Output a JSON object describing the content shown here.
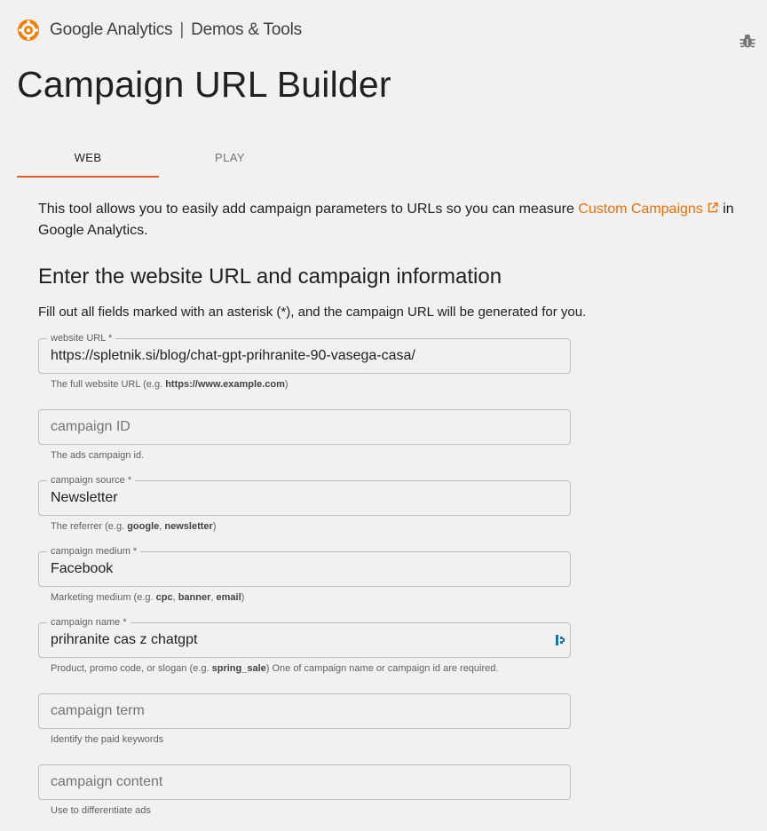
{
  "brand": {
    "name": "Google Analytics",
    "separator": "|",
    "section": "Demos & Tools"
  },
  "page_title": "Campaign URL Builder",
  "tabs": [
    {
      "label": "WEB",
      "active": true
    },
    {
      "label": "PLAY",
      "active": false
    }
  ],
  "intro": {
    "text_before": "This tool allows you to easily add campaign parameters to URLs so you can measure ",
    "link": "Custom Campaigns",
    "text_after": " in Google Analytics."
  },
  "section_title": "Enter the website URL and campaign information",
  "instructions": "Fill out all fields marked with an asterisk (*), and the campaign URL will be generated for you.",
  "fields": [
    {
      "label": "website URL *",
      "value": "https://spletnik.si/blog/chat-gpt-prihranite-90-vasega-casa/",
      "placeholder": "",
      "helper_pre": "The full website URL (e.g. ",
      "helper_b1": "https://www.example.com",
      "helper_mid": "",
      "helper_b2": "",
      "helper_mid2": "",
      "helper_b3": "",
      "helper_post": ")"
    },
    {
      "label": "",
      "value": "",
      "placeholder": "campaign ID",
      "helper_pre": "The ads campaign id.",
      "helper_b1": "",
      "helper_mid": "",
      "helper_b2": "",
      "helper_mid2": "",
      "helper_b3": "",
      "helper_post": ""
    },
    {
      "label": "campaign source *",
      "value": "Newsletter",
      "placeholder": "",
      "helper_pre": "The referrer (e.g. ",
      "helper_b1": "google",
      "helper_mid": ", ",
      "helper_b2": "newsletter",
      "helper_mid2": "",
      "helper_b3": "",
      "helper_post": ")"
    },
    {
      "label": "campaign medium *",
      "value": "Facebook",
      "placeholder": "",
      "helper_pre": "Marketing medium (e.g. ",
      "helper_b1": "cpc",
      "helper_mid": ", ",
      "helper_b2": "banner",
      "helper_mid2": ", ",
      "helper_b3": "email",
      "helper_post": ")"
    },
    {
      "label": "campaign name *",
      "value": "prihranite cas z chatgpt",
      "placeholder": "",
      "helper_pre": "Product, promo code, or slogan (e.g. ",
      "helper_b1": "spring_sale",
      "helper_mid": ") One of campaign name or campaign id are required.",
      "helper_b2": "",
      "helper_mid2": "",
      "helper_b3": "",
      "helper_post": ""
    },
    {
      "label": "",
      "value": "",
      "placeholder": "campaign term",
      "helper_pre": "Identify the paid keywords",
      "helper_b1": "",
      "helper_mid": "",
      "helper_b2": "",
      "helper_mid2": "",
      "helper_b3": "",
      "helper_post": ""
    },
    {
      "label": "",
      "value": "",
      "placeholder": "campaign content",
      "helper_pre": "Use to differentiate ads",
      "helper_b1": "",
      "helper_mid": "",
      "helper_b2": "",
      "helper_mid2": "",
      "helper_b3": "",
      "helper_post": ""
    }
  ],
  "colors": {
    "accent": "#e8592a",
    "link": "#e8710a",
    "background": "#f1f1f1"
  },
  "icons": [
    "analytics-logo-icon",
    "bug-icon",
    "external-link-icon",
    "password-manager-icon"
  ]
}
